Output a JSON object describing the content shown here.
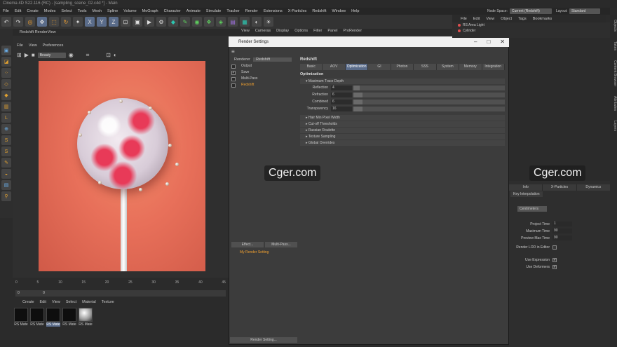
{
  "window_title": "Cinema 4D S22.116 (RC) - [sampling_scene_02.c4d *] - Main",
  "menu": [
    "File",
    "Edit",
    "Create",
    "Modes",
    "Select",
    "Tools",
    "Mesh",
    "Spline",
    "Volume",
    "MoGraph",
    "Character",
    "Animate",
    "Simulate",
    "Tracker",
    "Render",
    "Extensions",
    "X-Particles",
    "Redshift",
    "Window",
    "Help"
  ],
  "node_space": {
    "label": "Node Space:",
    "value": "Current (Redshift)"
  },
  "layout": {
    "label": "Layout:",
    "value": "Standard"
  },
  "object_manager_menu": [
    "File",
    "Edit",
    "View",
    "Object",
    "Tags",
    "Bookmarks"
  ],
  "objects": [
    "RS Area Light",
    "Cylinder"
  ],
  "render_view": {
    "title": "Redshift RenderView",
    "menu": [
      "File",
      "View",
      "Preferences"
    ],
    "aov_select": "Beauty"
  },
  "viewport_menu": [
    "View",
    "Cameras",
    "Display",
    "Options",
    "Filter",
    "Panel",
    "ProRender"
  ],
  "dialog": {
    "title": "Render Settings",
    "renderer_label": "Renderer",
    "renderer_value": "Redshift",
    "tree": [
      {
        "label": "Output",
        "checked": false
      },
      {
        "label": "Save",
        "checked": true
      },
      {
        "label": "Multi-Pass",
        "checked": false
      },
      {
        "label": "Redshift",
        "checked": false
      }
    ],
    "effect_btn": "Effect...",
    "multipass_btn": "Multi-Pass...",
    "setting_name": "My Render Setting",
    "render_setting_btn": "Render Setting...",
    "section_label": "Redshift",
    "tabs": [
      "Basic",
      "AOV",
      "Optimization",
      "GI",
      "Photon",
      "SSS",
      "System",
      "Memory",
      "Integration"
    ],
    "active_tab": "Optimization",
    "opt_title": "Optimization",
    "max_trace_depth": "Maximum Trace Depth",
    "params": [
      {
        "label": "Reflection",
        "value": "4",
        "fill": 0.04
      },
      {
        "label": "Refraction",
        "value": "6",
        "fill": 0.06
      },
      {
        "label": "Combined",
        "value": "6",
        "fill": 0.06
      },
      {
        "label": "Transparency",
        "value": "16",
        "fill": 0.06
      }
    ],
    "groups": [
      "Hair Min Pixel Width",
      "Cut-off Thresholds",
      "Russian Roulette",
      "Texture Sampling",
      "Global Overrides"
    ]
  },
  "watermark": "Cger.com",
  "timeline": {
    "ticks": [
      "0",
      "5",
      "10",
      "15",
      "20",
      "25",
      "30",
      "35",
      "40",
      "45"
    ],
    "start": "0",
    "end": "0"
  },
  "material_menu": [
    "Create",
    "Edit",
    "View",
    "Select",
    "Material",
    "Texture"
  ],
  "materials": [
    "RS Mate",
    "RS Mate",
    "RS Mate",
    "RS Mate",
    "RS Mate"
  ],
  "attributes": {
    "tabs": [
      "Info",
      "X-Particles",
      "Dynamics"
    ],
    "key_interp": "Key Interpolation",
    "units": "Centimeters",
    "rows": [
      {
        "label": "Project Time",
        "value": "1"
      },
      {
        "label": "Maximum Time",
        "value": "90"
      },
      {
        "label": "Preview Max Time",
        "value": "90"
      }
    ],
    "checks": [
      {
        "label": "Render LOD in Editor",
        "checked": false
      },
      {
        "label": "Use Expression",
        "checked": true
      },
      {
        "label": "Use Deformers",
        "checked": true
      }
    ]
  },
  "side_tabs": [
    "Objects",
    "Takes",
    "Content Browser",
    "Attributes",
    "Layers"
  ]
}
